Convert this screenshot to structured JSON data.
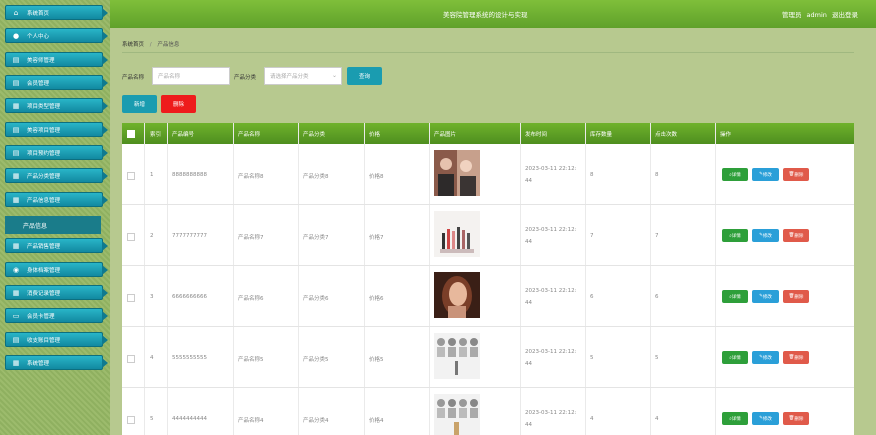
{
  "header": {
    "app_title": "美容院管理系统的设计与实现",
    "user_label": "管理员",
    "username": "admin",
    "logout": "退出登录"
  },
  "sidebar": {
    "items": [
      {
        "label": "系统首页",
        "icon": "home-icon"
      },
      {
        "label": "个人中心",
        "icon": "user-icon"
      },
      {
        "label": "美容师管理",
        "icon": "list-icon"
      },
      {
        "label": "会员管理",
        "icon": "list-icon"
      },
      {
        "label": "项目类型管理",
        "icon": "grid-icon"
      },
      {
        "label": "美容项目管理",
        "icon": "list-icon"
      },
      {
        "label": "项目预约管理",
        "icon": "list-icon"
      },
      {
        "label": "产品分类管理",
        "icon": "grid-icon"
      },
      {
        "label": "产品信息管理",
        "icon": "grid-icon"
      },
      {
        "label": "产品信息",
        "icon": ""
      },
      {
        "label": "产品销售管理",
        "icon": "grid-icon"
      },
      {
        "label": "身体档案管理",
        "icon": "location-icon"
      },
      {
        "label": "消费记录管理",
        "icon": "grid-icon"
      },
      {
        "label": "会员卡管理",
        "icon": "card-icon"
      },
      {
        "label": "收支账目管理",
        "icon": "list-icon"
      },
      {
        "label": "系统管理",
        "icon": "grid-icon"
      }
    ]
  },
  "breadcrumb": {
    "home": "系统首页",
    "sep": "/",
    "current": "产品信息"
  },
  "search": {
    "name_label": "产品名称",
    "name_placeholder": "产品名称",
    "category_label": "产品分类",
    "category_placeholder": "请选择产品分类",
    "query_button": "查询"
  },
  "actions": {
    "add": "新增",
    "delete": "删除"
  },
  "table": {
    "headers": [
      "索引",
      "产品编号",
      "产品名称",
      "产品分类",
      "价格",
      "产品图片",
      "发布时间",
      "库存数量",
      "点击次数",
      "操作"
    ],
    "row_buttons": {
      "detail": "详情",
      "edit": "修改",
      "remove": "删除"
    },
    "rows": [
      {
        "index": "1",
        "code": "8888888888",
        "name": "产品名称8",
        "category": "产品分类8",
        "price": "价格8",
        "time1": "2023-03-11 22:12:",
        "time2": "44",
        "stock": "8",
        "clicks": "8"
      },
      {
        "index": "2",
        "code": "7777777777",
        "name": "产品名称7",
        "category": "产品分类7",
        "price": "价格7",
        "time1": "2023-03-11 22:12:",
        "time2": "44",
        "stock": "7",
        "clicks": "7"
      },
      {
        "index": "3",
        "code": "6666666666",
        "name": "产品名称6",
        "category": "产品分类6",
        "price": "价格6",
        "time1": "2023-03-11 22:12:",
        "time2": "44",
        "stock": "6",
        "clicks": "6"
      },
      {
        "index": "4",
        "code": "5555555555",
        "name": "产品名称5",
        "category": "产品分类5",
        "price": "价格5",
        "time1": "2023-03-11 22:12:",
        "time2": "44",
        "stock": "5",
        "clicks": "5"
      },
      {
        "index": "5",
        "code": "4444444444",
        "name": "产品名称4",
        "category": "产品分类4",
        "price": "价格4",
        "time1": "2023-03-11 22:12:",
        "time2": "44",
        "stock": "4",
        "clicks": "4"
      }
    ]
  },
  "colors": {
    "nav": "#1a9cb0",
    "header": "#6fb22c",
    "detail": "#2e9f3a",
    "edit": "#2a9fd8",
    "remove": "#e05a4a",
    "delete_top": "#ee1c1c"
  }
}
